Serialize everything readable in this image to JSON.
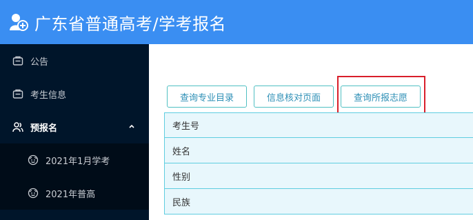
{
  "header": {
    "title": "广东省普通高考/学考报名",
    "bg_color": "#3a8ef2",
    "logo_icon": "user-plus-icon"
  },
  "sidebar": {
    "bg_color": "#00152a",
    "items": [
      {
        "label": "公告",
        "icon": "id-card-icon"
      },
      {
        "label": "考生信息",
        "icon": "id-card-icon"
      },
      {
        "label": "预报名",
        "icon": "users-icon",
        "expanded": true
      }
    ],
    "submenu": [
      {
        "label": "2021年1月学考",
        "icon": "smile-icon"
      },
      {
        "label": "2021年普高",
        "icon": "smile-icon"
      }
    ]
  },
  "toolbar": {
    "buttons": [
      {
        "label": "查询专业目录"
      },
      {
        "label": "信息核对页面"
      },
      {
        "label": "查询所报志愿",
        "highlighted": true
      }
    ],
    "highlight_color": "#d81e2a"
  },
  "info_table": {
    "rows": [
      {
        "label": "考生号"
      },
      {
        "label": "姓名"
      },
      {
        "label": "性别"
      },
      {
        "label": "民族"
      }
    ]
  }
}
